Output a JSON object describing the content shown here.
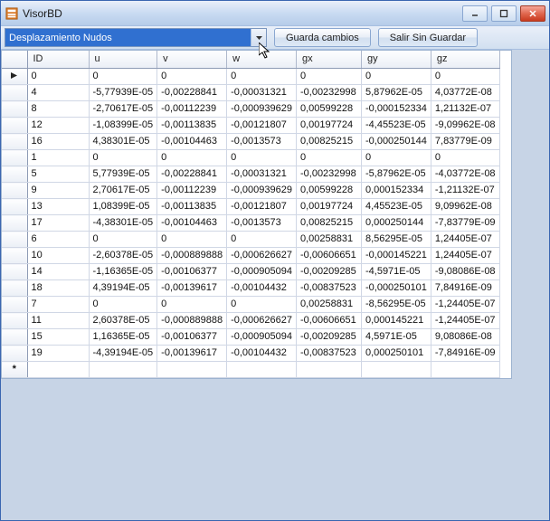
{
  "window": {
    "title": "VisorBD"
  },
  "toolbar": {
    "combo_value": "Desplazamiento Nudos",
    "save_label": "Guarda cambios",
    "exit_label": "Salir Sin Guardar"
  },
  "grid": {
    "columns": [
      "ID",
      "u",
      "v",
      "w",
      "gx",
      "gy",
      "gz"
    ],
    "rows": [
      {
        "id": "0",
        "u": "0",
        "v": "0",
        "w": "0",
        "gx": "0",
        "gy": "0",
        "gz": "0"
      },
      {
        "id": "4",
        "u": "-5,77939E-05",
        "v": "-0,00228841",
        "w": "-0,00031321",
        "gx": "-0,00232998",
        "gy": "5,87962E-05",
        "gz": "4,03772E-08"
      },
      {
        "id": "8",
        "u": "-2,70617E-05",
        "v": "-0,00112239",
        "w": "-0,000939629",
        "gx": "0,00599228",
        "gy": "-0,000152334",
        "gz": "1,21132E-07"
      },
      {
        "id": "12",
        "u": "-1,08399E-05",
        "v": "-0,00113835",
        "w": "-0,00121807",
        "gx": "0,00197724",
        "gy": "-4,45523E-05",
        "gz": "-9,09962E-08"
      },
      {
        "id": "16",
        "u": "4,38301E-05",
        "v": "-0,00104463",
        "w": "-0,0013573",
        "gx": "0,00825215",
        "gy": "-0,000250144",
        "gz": "7,83779E-09"
      },
      {
        "id": "1",
        "u": "0",
        "v": "0",
        "w": "0",
        "gx": "0",
        "gy": "0",
        "gz": "0"
      },
      {
        "id": "5",
        "u": "5,77939E-05",
        "v": "-0,00228841",
        "w": "-0,00031321",
        "gx": "-0,00232998",
        "gy": "-5,87962E-05",
        "gz": "-4,03772E-08"
      },
      {
        "id": "9",
        "u": "2,70617E-05",
        "v": "-0,00112239",
        "w": "-0,000939629",
        "gx": "0,00599228",
        "gy": "0,000152334",
        "gz": "-1,21132E-07"
      },
      {
        "id": "13",
        "u": "1,08399E-05",
        "v": "-0,00113835",
        "w": "-0,00121807",
        "gx": "0,00197724",
        "gy": "4,45523E-05",
        "gz": "9,09962E-08"
      },
      {
        "id": "17",
        "u": "-4,38301E-05",
        "v": "-0,00104463",
        "w": "-0,0013573",
        "gx": "0,00825215",
        "gy": "0,000250144",
        "gz": "-7,83779E-09"
      },
      {
        "id": "6",
        "u": "0",
        "v": "0",
        "w": "0",
        "gx": "0,00258831",
        "gy": "8,56295E-05",
        "gz": "1,24405E-07"
      },
      {
        "id": "10",
        "u": "-2,60378E-05",
        "v": "-0,000889888",
        "w": "-0,000626627",
        "gx": "-0,00606651",
        "gy": "-0,000145221",
        "gz": "1,24405E-07"
      },
      {
        "id": "14",
        "u": "-1,16365E-05",
        "v": "-0,00106377",
        "w": "-0,000905094",
        "gx": "-0,00209285",
        "gy": "-4,5971E-05",
        "gz": "-9,08086E-08"
      },
      {
        "id": "18",
        "u": "4,39194E-05",
        "v": "-0,00139617",
        "w": "-0,00104432",
        "gx": "-0,00837523",
        "gy": "-0,000250101",
        "gz": "7,84916E-09"
      },
      {
        "id": "7",
        "u": "0",
        "v": "0",
        "w": "0",
        "gx": "0,00258831",
        "gy": "-8,56295E-05",
        "gz": "-1,24405E-07"
      },
      {
        "id": "11",
        "u": "2,60378E-05",
        "v": "-0,000889888",
        "w": "-0,000626627",
        "gx": "-0,00606651",
        "gy": "0,000145221",
        "gz": "-1,24405E-07"
      },
      {
        "id": "15",
        "u": "1,16365E-05",
        "v": "-0,00106377",
        "w": "-0,000905094",
        "gx": "-0,00209285",
        "gy": "4,5971E-05",
        "gz": "9,08086E-08"
      },
      {
        "id": "19",
        "u": "-4,39194E-05",
        "v": "-0,00139617",
        "w": "-0,00104432",
        "gx": "-0,00837523",
        "gy": "0,000250101",
        "gz": "-7,84916E-09"
      }
    ]
  }
}
